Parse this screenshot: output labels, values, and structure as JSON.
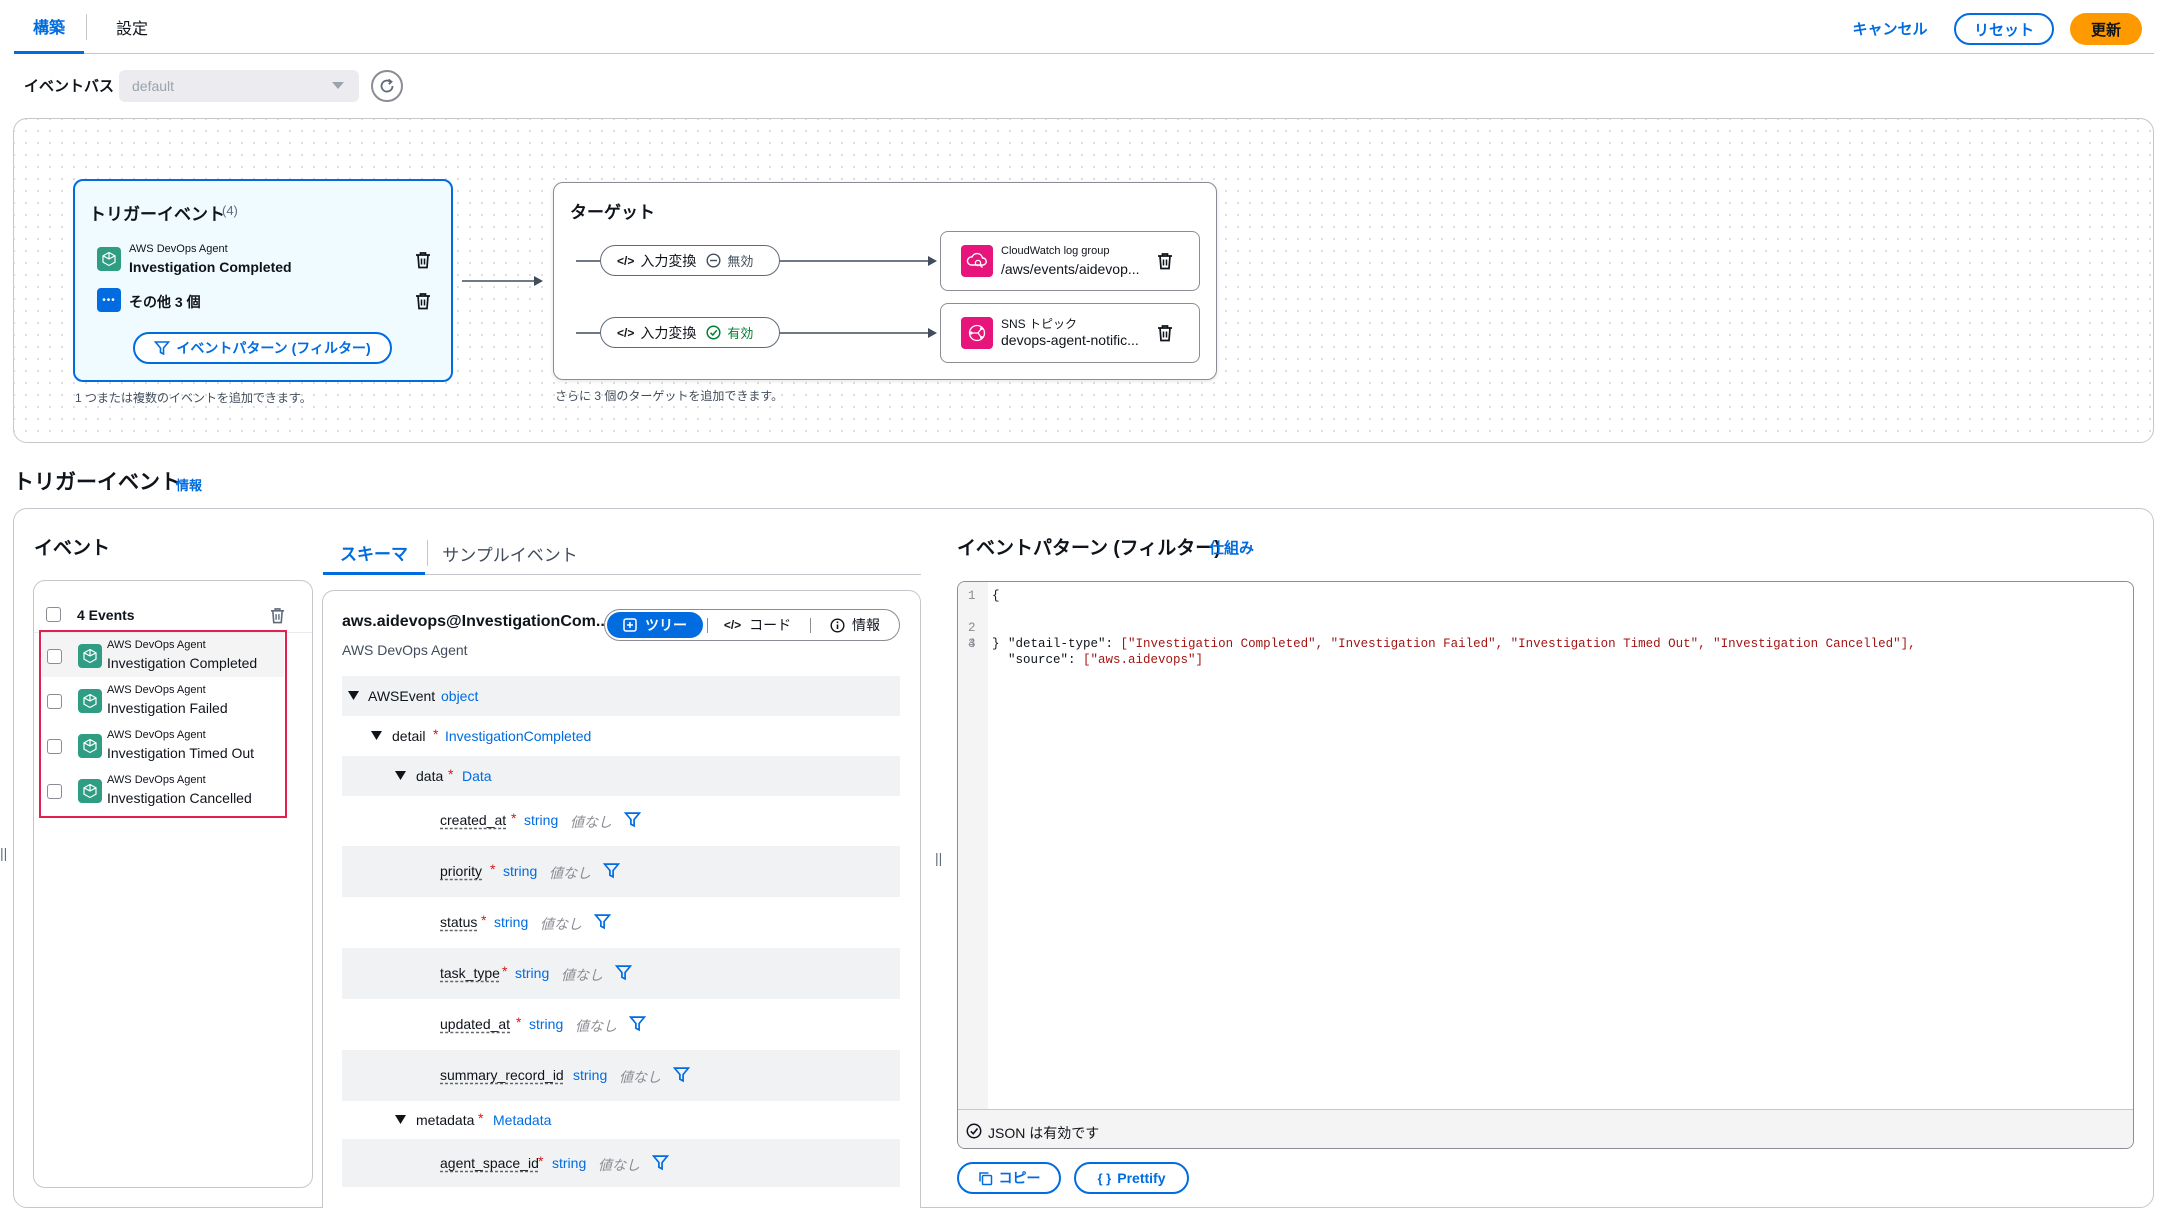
{
  "tabs": [
    {
      "label": "構築",
      "active": true
    },
    {
      "label": "設定",
      "active": false
    }
  ],
  "header_actions": {
    "cancel": "キャンセル",
    "reset": "リセット",
    "update": "更新"
  },
  "event_bus": {
    "label": "イベントバス",
    "value": "default"
  },
  "diagram": {
    "trigger": {
      "title": "トリガーイベント",
      "count": "(4)",
      "event_source": "AWS DevOps Agent",
      "event_name": "Investigation Completed",
      "others": "その他 3 個",
      "filter_button": "イベントパターン (フィルター)",
      "hint": "1 つまたは複数のイベントを追加できます。"
    },
    "targets": {
      "title": "ターゲット",
      "hint": "さらに 3 個のターゲットを追加できます。",
      "items": [
        {
          "transform": "入力変換",
          "state": "無効",
          "type": "CloudWatch log group",
          "name": "/aws/events/aidevop..."
        },
        {
          "transform": "入力変換",
          "state": "有効",
          "type": "SNS トピック",
          "name": "devops-agent-notific..."
        }
      ]
    }
  },
  "section": {
    "title": "トリガーイベント",
    "info": "情報"
  },
  "events_panel": {
    "title": "イベント",
    "header": "4 Events",
    "items": [
      {
        "source": "AWS DevOps Agent",
        "name": "Investigation Completed"
      },
      {
        "source": "AWS DevOps Agent",
        "name": "Investigation Failed"
      },
      {
        "source": "AWS DevOps Agent",
        "name": "Investigation Timed Out"
      },
      {
        "source": "AWS DevOps Agent",
        "name": "Investigation Cancelled"
      }
    ]
  },
  "schema_panel": {
    "tabs": [
      {
        "label": "スキーマ",
        "active": true
      },
      {
        "label": "サンプルイベント",
        "active": false
      }
    ],
    "title": "aws.aidevops@InvestigationCom...",
    "subtitle": "AWS DevOps Agent",
    "view_toggle": {
      "tree": "ツリー",
      "code": "コード",
      "info": "情報"
    },
    "root": {
      "name": "AWSEvent",
      "type": "object"
    },
    "detail": {
      "name": "detail",
      "type": "InvestigationCompleted"
    },
    "data": {
      "name": "data",
      "type": "Data"
    },
    "fields": [
      {
        "name": "created_at",
        "type": "string",
        "value": "値なし"
      },
      {
        "name": "priority",
        "type": "string",
        "value": "値なし"
      },
      {
        "name": "status",
        "type": "string",
        "value": "値なし"
      },
      {
        "name": "task_type",
        "type": "string",
        "value": "値なし"
      },
      {
        "name": "updated_at",
        "type": "string",
        "value": "値なし"
      },
      {
        "name": "summary_record_id",
        "type": "string",
        "value": "値なし"
      }
    ],
    "metadata": {
      "name": "metadata",
      "type": "Metadata"
    },
    "metadata_fields": [
      {
        "name": "agent_space_id",
        "type": "string",
        "value": "値なし"
      }
    ]
  },
  "pattern_panel": {
    "title": "イベントパターン (フィルター)",
    "link": "仕組み",
    "lines": [
      {
        "no": "1",
        "code": "{"
      },
      {
        "no": "2",
        "key": "\"detail-type\"",
        "value": "[\"Investigation Completed\", \"Investigation Failed\", \"Investigation Timed Out\", \"Investigation Cancelled\"],"
      },
      {
        "no": "3",
        "key": "\"source\"",
        "value": "[\"aws.aidevops\"]"
      },
      {
        "no": "4",
        "code": "}"
      }
    ],
    "status": "JSON は有効です",
    "copy": "コピー",
    "prettify": "Prettify"
  },
  "colors": {
    "primary": "#006ce0",
    "accent": "#ff9900",
    "highlight": "#e4204f",
    "event_icon": "#2e9d83",
    "target_icon": "#e7157b"
  }
}
